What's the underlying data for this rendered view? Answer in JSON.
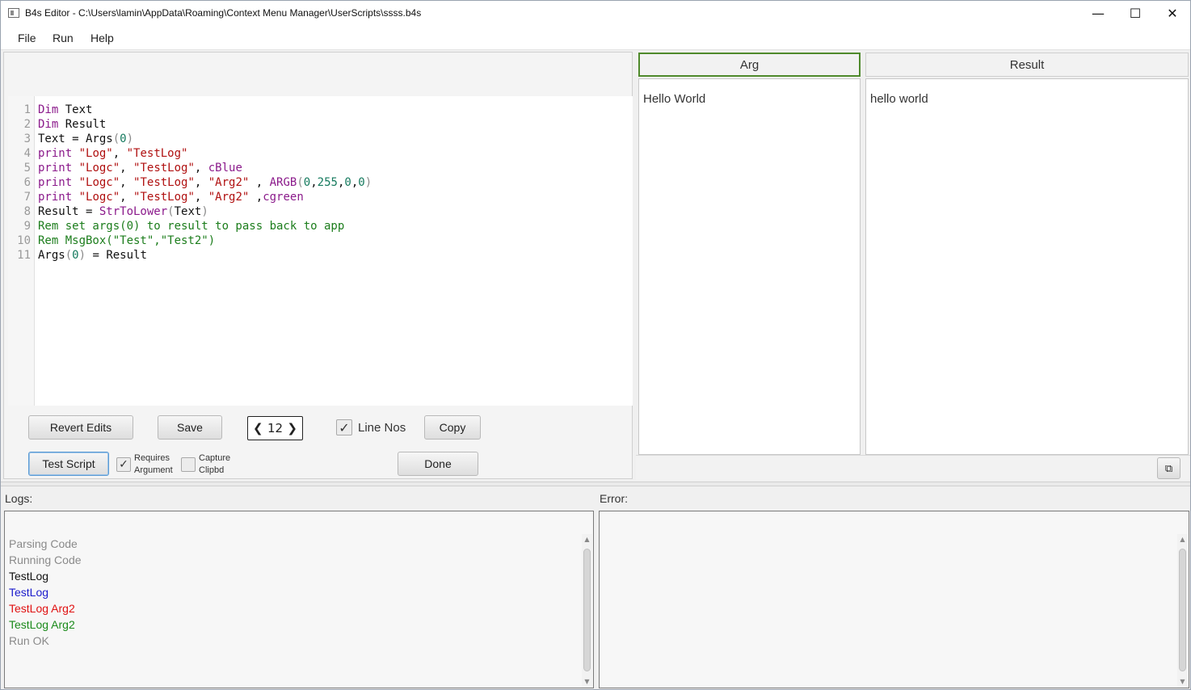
{
  "window": {
    "title": "B4s Editor - C:\\Users\\lamin\\AppData\\Roaming\\Context Menu Manager\\UserScripts\\ssss.b4s",
    "minimize_glyph": "—",
    "maximize_glyph": "☐",
    "close_glyph": "✕"
  },
  "menu": [
    "File",
    "Run",
    "Help"
  ],
  "editor": {
    "line_numbers": [
      "1",
      "2",
      "3",
      "4",
      "5",
      "6",
      "7",
      "8",
      "9",
      "10",
      "11"
    ]
  },
  "toolbar": {
    "revert_label": "Revert Edits",
    "save_label": "Save",
    "font_size_value": "12",
    "prev_glyph": "❮",
    "next_glyph": "❯",
    "line_nos_label": "Line Nos",
    "line_nos_checked": true,
    "copy_label": "Copy",
    "test_script_label": "Test Script",
    "requires_argument_label_1": "Requires",
    "requires_argument_label_2": "Argument",
    "requires_argument_checked": true,
    "capture_clipbd_label_1": "Capture",
    "capture_clipbd_label_2": "Clipbd",
    "capture_clipbd_checked": false,
    "done_label": "Done",
    "check_glyph": "✓"
  },
  "arg_panel": {
    "header": "Arg",
    "value": "Hello World"
  },
  "result_panel": {
    "header": "Result",
    "value": "hello world",
    "copy_icon": "⧉"
  },
  "logs": {
    "label": "Logs:",
    "lines": [
      {
        "text": "Parsing Code",
        "color": "#8a8a8a"
      },
      {
        "text": "Running Code",
        "color": "#8a8a8a"
      },
      {
        "text": "TestLog",
        "color": "#111111"
      },
      {
        "text": "TestLog",
        "color": "#1a1acc"
      },
      {
        "text": "TestLog Arg2",
        "color": "#e01010"
      },
      {
        "text": "TestLog Arg2",
        "color": "#1a8a1a"
      },
      {
        "text": "Run OK",
        "color": "#8a8a8a"
      }
    ]
  },
  "error": {
    "label": "Error:"
  },
  "scroll_glyphs": {
    "up": "▲",
    "down": "▼"
  }
}
